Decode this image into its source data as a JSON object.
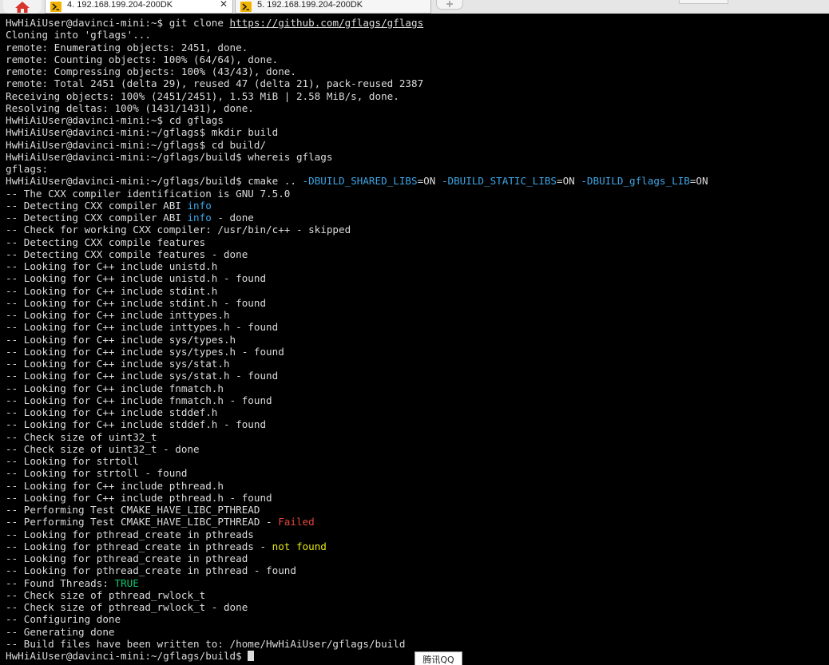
{
  "tabs": [
    {
      "label": "4. 192.168.199.204-200DK",
      "close": "✕",
      "active": true
    },
    {
      "label": "5. 192.168.199.204-200DK",
      "active": false
    }
  ],
  "icons": {
    "home": "home-icon",
    "terminal": "terminal-session-icon",
    "new_tab": "new-tab-icon"
  },
  "colors": {
    "terminal_bg": "#000000",
    "terminal_fg": "#dcdcdc",
    "blue": "#3ea5e5",
    "red": "#e2463f",
    "yellow": "#e5e510",
    "green": "#15c46f"
  },
  "terminal": {
    "lines": [
      [
        {
          "t": "HwHiAiUser@davinci-mini:~$ git clone "
        },
        {
          "t": "https://github.com/gflags/gflags",
          "c": "link"
        }
      ],
      [
        {
          "t": "Cloning into 'gflags'..."
        }
      ],
      [
        {
          "t": "remote: Enumerating objects: 2451, done."
        }
      ],
      [
        {
          "t": "remote: Counting objects: 100% (64/64), done."
        }
      ],
      [
        {
          "t": "remote: Compressing objects: 100% (43/43), done."
        }
      ],
      [
        {
          "t": "remote: Total 2451 (delta 29), reused 47 (delta 21), pack-reused 2387"
        }
      ],
      [
        {
          "t": "Receiving objects: 100% (2451/2451), 1.53 MiB | 2.58 MiB/s, done."
        }
      ],
      [
        {
          "t": "Resolving deltas: 100% (1431/1431), done."
        }
      ],
      [
        {
          "t": "HwHiAiUser@davinci-mini:~$ cd gflags"
        }
      ],
      [
        {
          "t": "HwHiAiUser@davinci-mini:~/gflags$ mkdir build"
        }
      ],
      [
        {
          "t": "HwHiAiUser@davinci-mini:~/gflags$ cd build/"
        }
      ],
      [
        {
          "t": "HwHiAiUser@davinci-mini:~/gflags/build$ whereis gflags"
        }
      ],
      [
        {
          "t": "gflags:"
        }
      ],
      [
        {
          "t": "HwHiAiUser@davinci-mini:~/gflags/build$ cmake .. "
        },
        {
          "t": "-DBUILD_SHARED_LIBS",
          "c": "blue"
        },
        {
          "t": "=ON "
        },
        {
          "t": "-DBUILD_STATIC_LIBS",
          "c": "blue"
        },
        {
          "t": "=ON "
        },
        {
          "t": "-DBUILD_gflags_LIB",
          "c": "blue"
        },
        {
          "t": "=ON"
        }
      ],
      [
        {
          "t": "-- The CXX compiler identification is GNU 7.5.0"
        }
      ],
      [
        {
          "t": "-- Detecting CXX compiler ABI "
        },
        {
          "t": "info",
          "c": "blue"
        }
      ],
      [
        {
          "t": "-- Detecting CXX compiler ABI "
        },
        {
          "t": "info",
          "c": "blue"
        },
        {
          "t": " - done"
        }
      ],
      [
        {
          "t": "-- Check for working CXX compiler: /usr/bin/c++ - skipped"
        }
      ],
      [
        {
          "t": "-- Detecting CXX compile features"
        }
      ],
      [
        {
          "t": "-- Detecting CXX compile features - done"
        }
      ],
      [
        {
          "t": "-- Looking for C++ include unistd.h"
        }
      ],
      [
        {
          "t": "-- Looking for C++ include unistd.h - found"
        }
      ],
      [
        {
          "t": "-- Looking for C++ include stdint.h"
        }
      ],
      [
        {
          "t": "-- Looking for C++ include stdint.h - found"
        }
      ],
      [
        {
          "t": "-- Looking for C++ include inttypes.h"
        }
      ],
      [
        {
          "t": "-- Looking for C++ include inttypes.h - found"
        }
      ],
      [
        {
          "t": "-- Looking for C++ include sys/types.h"
        }
      ],
      [
        {
          "t": "-- Looking for C++ include sys/types.h - found"
        }
      ],
      [
        {
          "t": "-- Looking for C++ include sys/stat.h"
        }
      ],
      [
        {
          "t": "-- Looking for C++ include sys/stat.h - found"
        }
      ],
      [
        {
          "t": "-- Looking for C++ include fnmatch.h"
        }
      ],
      [
        {
          "t": "-- Looking for C++ include fnmatch.h - found"
        }
      ],
      [
        {
          "t": "-- Looking for C++ include stddef.h"
        }
      ],
      [
        {
          "t": "-- Looking for C++ include stddef.h - found"
        }
      ],
      [
        {
          "t": "-- Check size of uint32_t"
        }
      ],
      [
        {
          "t": "-- Check size of uint32_t - done"
        }
      ],
      [
        {
          "t": "-- Looking for strtoll"
        }
      ],
      [
        {
          "t": "-- Looking for strtoll - found"
        }
      ],
      [
        {
          "t": "-- Looking for C++ include pthread.h"
        }
      ],
      [
        {
          "t": "-- Looking for C++ include pthread.h - found"
        }
      ],
      [
        {
          "t": "-- Performing Test CMAKE_HAVE_LIBC_PTHREAD"
        }
      ],
      [
        {
          "t": "-- Performing Test CMAKE_HAVE_LIBC_PTHREAD - "
        },
        {
          "t": "Failed",
          "c": "red"
        }
      ],
      [
        {
          "t": "-- Looking for pthread_create in pthreads"
        }
      ],
      [
        {
          "t": "-- Looking for pthread_create in pthreads - "
        },
        {
          "t": "not found",
          "c": "yellow"
        }
      ],
      [
        {
          "t": "-- Looking for pthread_create in pthread"
        }
      ],
      [
        {
          "t": "-- Looking for pthread_create in pthread - found"
        }
      ],
      [
        {
          "t": "-- Found Threads: "
        },
        {
          "t": "TRUE",
          "c": "green"
        }
      ],
      [
        {
          "t": "-- Check size of pthread_rwlock_t"
        }
      ],
      [
        {
          "t": "-- Check size of pthread_rwlock_t - done"
        }
      ],
      [
        {
          "t": "-- Configuring done"
        }
      ],
      [
        {
          "t": "-- Generating done"
        }
      ],
      [
        {
          "t": "-- Build files have been written to: /home/HwHiAiUser/gflags/build"
        }
      ],
      [
        {
          "t": "HwHiAiUser@davinci-mini:~/gflags/build$ "
        }
      ]
    ]
  },
  "tooltip": {
    "text": "腾讯QQ"
  }
}
